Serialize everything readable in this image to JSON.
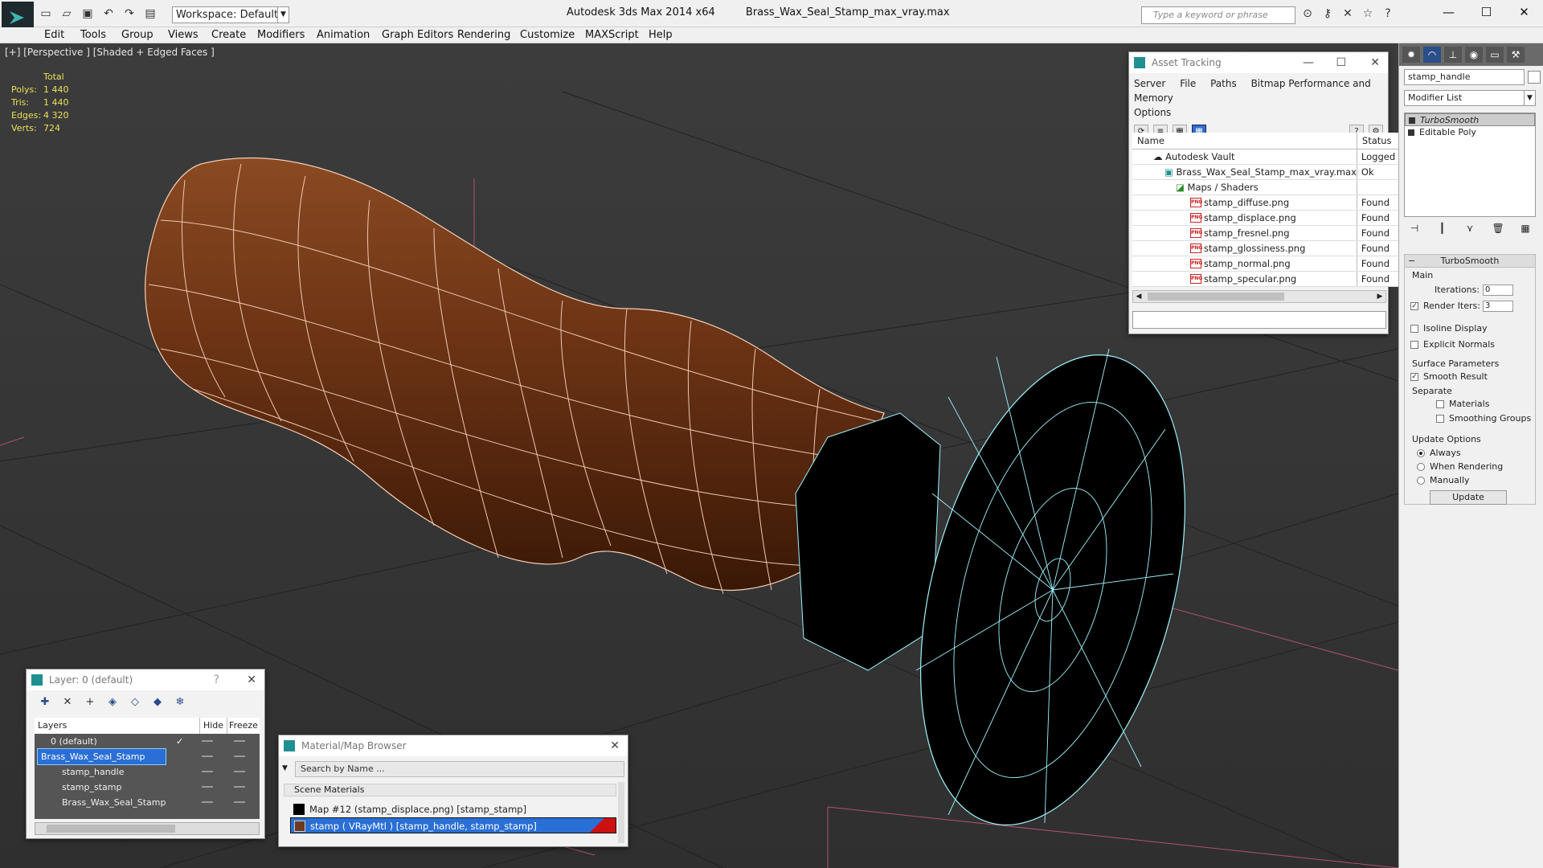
{
  "titlebar": {
    "workspace": "Workspace: Default",
    "app_title": "Autodesk 3ds Max  2014 x64",
    "file_title": "Brass_Wax_Seal_Stamp_max_vray.max",
    "search_placeholder": "Type a keyword or phrase"
  },
  "menu": [
    "Edit",
    "Tools",
    "Group",
    "Views",
    "Create",
    "Modifiers",
    "Animation",
    "Graph Editors",
    "Rendering",
    "Customize",
    "MAXScript",
    "Help"
  ],
  "viewport": {
    "label": "[+] [Perspective ] [Shaded + Edged Faces ]",
    "stats_header": "Total",
    "stats": [
      {
        "k": "Polys:",
        "v": "1 440"
      },
      {
        "k": "Tris:",
        "v": "1 440"
      },
      {
        "k": "Edges:",
        "v": "4 320"
      },
      {
        "k": "Verts:",
        "v": "724"
      }
    ]
  },
  "asset_tracking": {
    "title": "Asset Tracking",
    "menu": [
      "Server",
      "File",
      "Paths",
      "Bitmap Performance and Memory"
    ],
    "menu2": "Options",
    "col_name": "Name",
    "col_status": "Status",
    "rows": [
      {
        "name": "Autodesk Vault",
        "status": "Logged Out",
        "indent": 1
      },
      {
        "name": "Brass_Wax_Seal_Stamp_max_vray.max",
        "status": "Ok",
        "indent": 2
      },
      {
        "name": "Maps / Shaders",
        "status": "",
        "indent": 3
      },
      {
        "name": "stamp_diffuse.png",
        "status": "Found",
        "indent": 4
      },
      {
        "name": "stamp_displace.png",
        "status": "Found",
        "indent": 4
      },
      {
        "name": "stamp_fresnel.png",
        "status": "Found",
        "indent": 4
      },
      {
        "name": "stamp_glossiness.png",
        "status": "Found",
        "indent": 4
      },
      {
        "name": "stamp_normal.png",
        "status": "Found",
        "indent": 4
      },
      {
        "name": "stamp_specular.png",
        "status": "Found",
        "indent": 4
      }
    ]
  },
  "layer_panel": {
    "title": "Layer: 0 (default)",
    "col_layers": "Layers",
    "col_hide": "Hide",
    "col_freeze": "Freeze",
    "rows": [
      "0 (default)",
      "Brass_Wax_Seal_Stamp",
      "stamp_handle",
      "stamp_stamp",
      "Brass_Wax_Seal_Stamp"
    ]
  },
  "material_browser": {
    "title": "Material/Map Browser",
    "search_placeholder": "Search by Name ...",
    "group": "Scene Materials",
    "items": [
      "Map #12 (stamp_displace.png) [stamp_stamp]",
      "stamp  ( VRayMtl )  [stamp_handle, stamp_stamp]"
    ]
  },
  "command_panel": {
    "object_name": "stamp_handle",
    "modifier_list": "Modifier List",
    "stack": [
      "TurboSmooth",
      "Editable Poly"
    ],
    "rollout_title": "TurboSmooth",
    "main_label": "Main",
    "iterations_label": "Iterations:",
    "iterations_value": "0",
    "render_iters_label": "Render Iters:",
    "render_iters_value": "3",
    "isoline": "Isoline Display",
    "explicit_normals": "Explicit Normals",
    "surface_params": "Surface Parameters",
    "smooth_result": "Smooth Result",
    "separate": "Separate",
    "materials": "Materials",
    "smoothing_groups": "Smoothing Groups",
    "update_options": "Update Options",
    "always": "Always",
    "when_rendering": "When Rendering",
    "manually": "Manually",
    "update_button": "Update"
  }
}
